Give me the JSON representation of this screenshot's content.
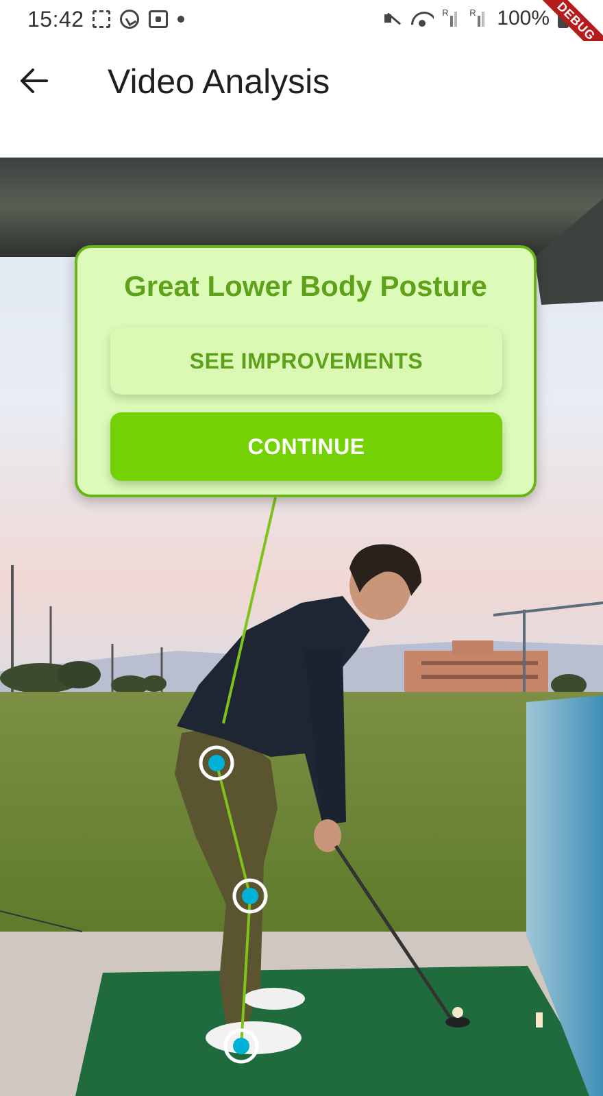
{
  "status_bar": {
    "time": "15:42",
    "battery": "100%",
    "signal_label_1": "R",
    "signal_label_2": "R",
    "debug_banner": "DEBUG"
  },
  "app_bar": {
    "title": "Video Analysis",
    "back_icon": "arrow-left-icon"
  },
  "feedback_card": {
    "title": "Great Lower Body Posture",
    "see_improvements_label": "SEE IMPROVEMENTS",
    "continue_label": "CONTINUE"
  },
  "colors": {
    "accent_green": "#74d204",
    "card_background": "#ddfbb8",
    "card_border": "#6bb31c",
    "title_green": "#5ea11a",
    "joint_cyan": "#00b3d6",
    "pose_line": "#7fc31a"
  },
  "pose_joints": [
    "hip",
    "knee",
    "ankle"
  ]
}
